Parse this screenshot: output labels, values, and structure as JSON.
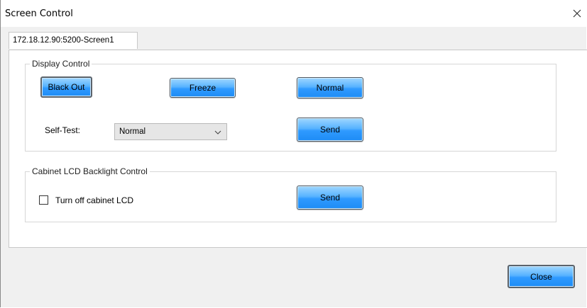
{
  "window": {
    "title": "Screen Control"
  },
  "tabs": [
    {
      "label": "172.18.12.90:5200-Screen1"
    }
  ],
  "display_control": {
    "group_label": "Display Control",
    "black_out_label": "Black Out",
    "freeze_label": "Freeze",
    "normal_label": "Normal",
    "self_test_label": "Self-Test:",
    "self_test_value": "Normal",
    "send_label": "Send"
  },
  "backlight_control": {
    "group_label": "Cabinet LCD Backlight Control",
    "checkbox_label": "Turn off cabinet LCD",
    "checkbox_checked": false,
    "send_label": "Send"
  },
  "footer": {
    "close_label": "Close"
  },
  "icons": {
    "close": "close-icon",
    "dropdown": "chevron-down-icon"
  },
  "colors": {
    "button_top": "#9fd6ff",
    "button_bottom": "#1e8cf5",
    "panel_border": "#c8c8c8"
  }
}
